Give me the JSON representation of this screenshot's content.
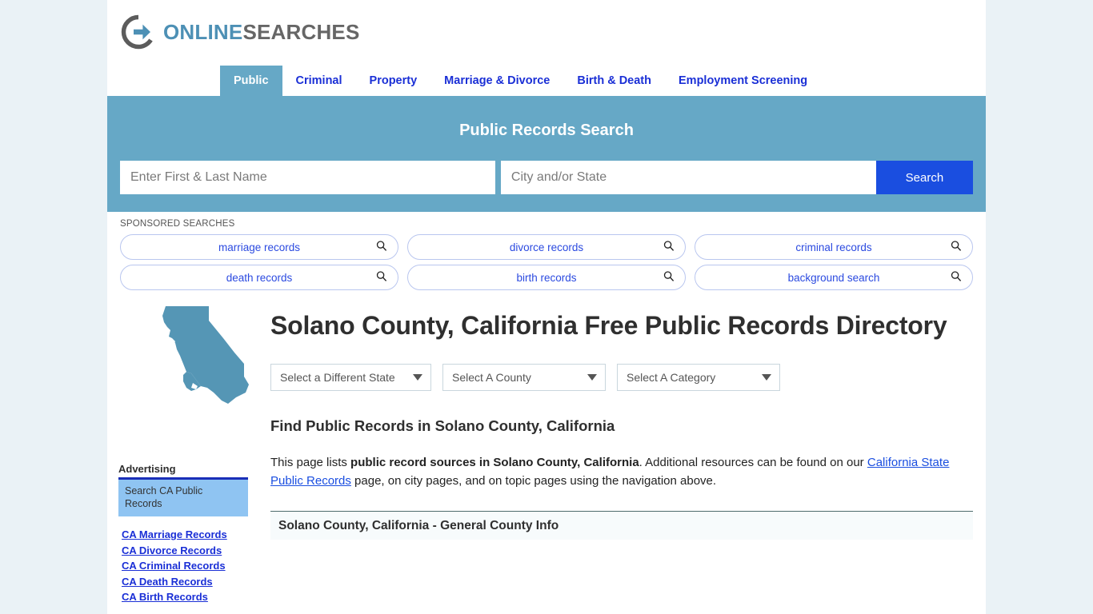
{
  "brand": {
    "name_part1": "ONLINE",
    "name_part2": "SEARCHES",
    "logo_icon": "circle-arrow-right-icon",
    "accent_blue": "#4d90b5",
    "accent_gray": "#666666"
  },
  "nav": {
    "tabs": [
      {
        "label": "Public",
        "active": true
      },
      {
        "label": "Criminal",
        "active": false
      },
      {
        "label": "Property",
        "active": false
      },
      {
        "label": "Marriage & Divorce",
        "active": false
      },
      {
        "label": "Birth & Death",
        "active": false
      },
      {
        "label": "Employment Screening",
        "active": false
      }
    ]
  },
  "search_banner": {
    "title": "Public Records Search",
    "name_placeholder": "Enter First & Last Name",
    "name_value": "",
    "location_placeholder": "City and/or State",
    "location_value": "",
    "button_label": "Search",
    "background": "#66a8c6",
    "button_color": "#1a4ee0"
  },
  "sponsored": {
    "label": "SPONSORED SEARCHES",
    "items": [
      {
        "label": "marriage records",
        "icon": "search-icon"
      },
      {
        "label": "divorce records",
        "icon": "search-icon"
      },
      {
        "label": "criminal records",
        "icon": "search-icon"
      },
      {
        "label": "death records",
        "icon": "search-icon"
      },
      {
        "label": "birth records",
        "icon": "search-icon"
      },
      {
        "label": "background search",
        "icon": "search-icon"
      }
    ]
  },
  "main": {
    "state_map_icon": "california-state-outline-icon",
    "page_title": "Solano County, California Free Public Records Directory",
    "selects": [
      {
        "name": "state",
        "value": "Select a Different State"
      },
      {
        "name": "county",
        "value": "Select A County"
      },
      {
        "name": "category",
        "value": "Select A Category"
      }
    ],
    "section_heading": "Find Public Records in Solano County, California",
    "intro": {
      "part1": "This page lists ",
      "bold1": "public record sources in Solano County, California",
      "part2": ". Additional resources can be found on our ",
      "link": "California State Public Records",
      "part3": " page, on city pages, and on topic pages using the navigation above."
    },
    "table_header": "Solano County, California - General County Info"
  },
  "sidebar": {
    "advertising_label": "Advertising",
    "ad_text": "Search CA Public Records",
    "links": [
      "CA Marriage Records",
      "CA Divorce Records",
      "CA Criminal Records",
      "CA Death Records",
      "CA Birth Records"
    ]
  }
}
